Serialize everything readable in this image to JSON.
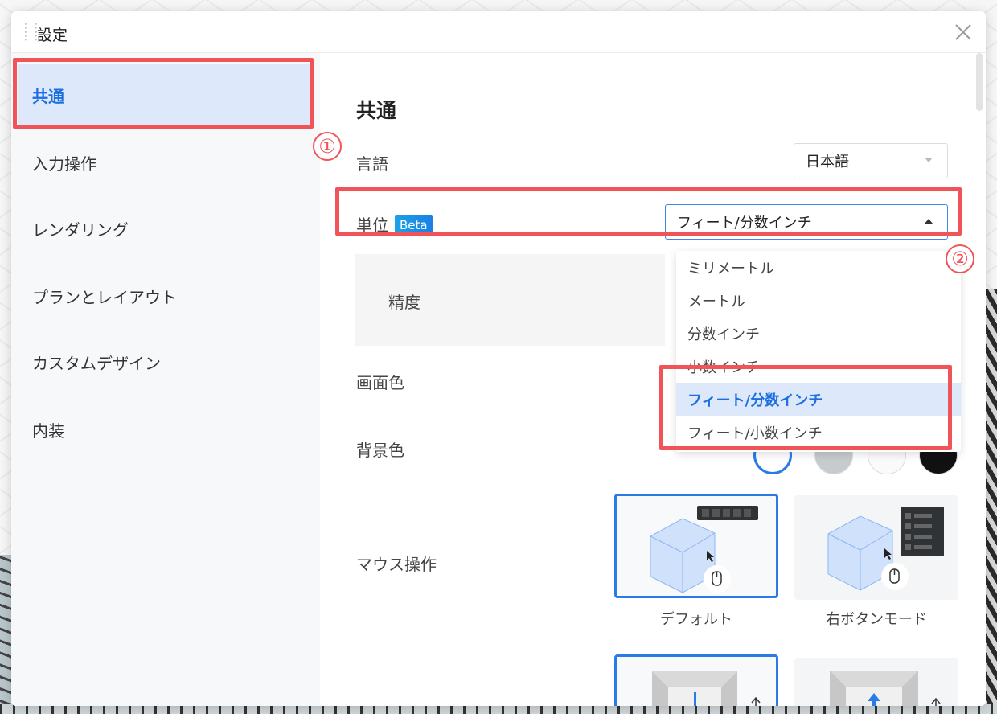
{
  "dialog": {
    "title": "設定",
    "close_icon": "close-icon"
  },
  "sidebar": {
    "items": [
      {
        "label": "共通",
        "active": true
      },
      {
        "label": "入力操作"
      },
      {
        "label": "レンダリング"
      },
      {
        "label": "プランとレイアウト"
      },
      {
        "label": "カスタムデザイン"
      },
      {
        "label": "内装"
      }
    ]
  },
  "annotations": [
    "①",
    "②"
  ],
  "main": {
    "section_title": "共通",
    "language": {
      "label": "言語",
      "value": "日本語"
    },
    "unit": {
      "label": "単位",
      "badge": "Beta",
      "value": "フィート/分数インチ",
      "options": [
        "ミリメートル",
        "メートル",
        "分数インチ",
        "小数インチ",
        "フィート/分数インチ",
        "フィート/小数インチ"
      ],
      "selected_index": 4
    },
    "precision": {
      "label": "精度"
    },
    "screen_color": {
      "label": "画面色"
    },
    "background_color": {
      "label": "背景色"
    },
    "mouse": {
      "label": "マウス操作",
      "modes": [
        {
          "caption": "デフォルト",
          "selected": true
        },
        {
          "caption": "右ボタンモード"
        }
      ]
    }
  },
  "colors": {
    "accent": "#1d6fe0",
    "annotation": "#f05459",
    "active_bg": "#dde9fb"
  }
}
